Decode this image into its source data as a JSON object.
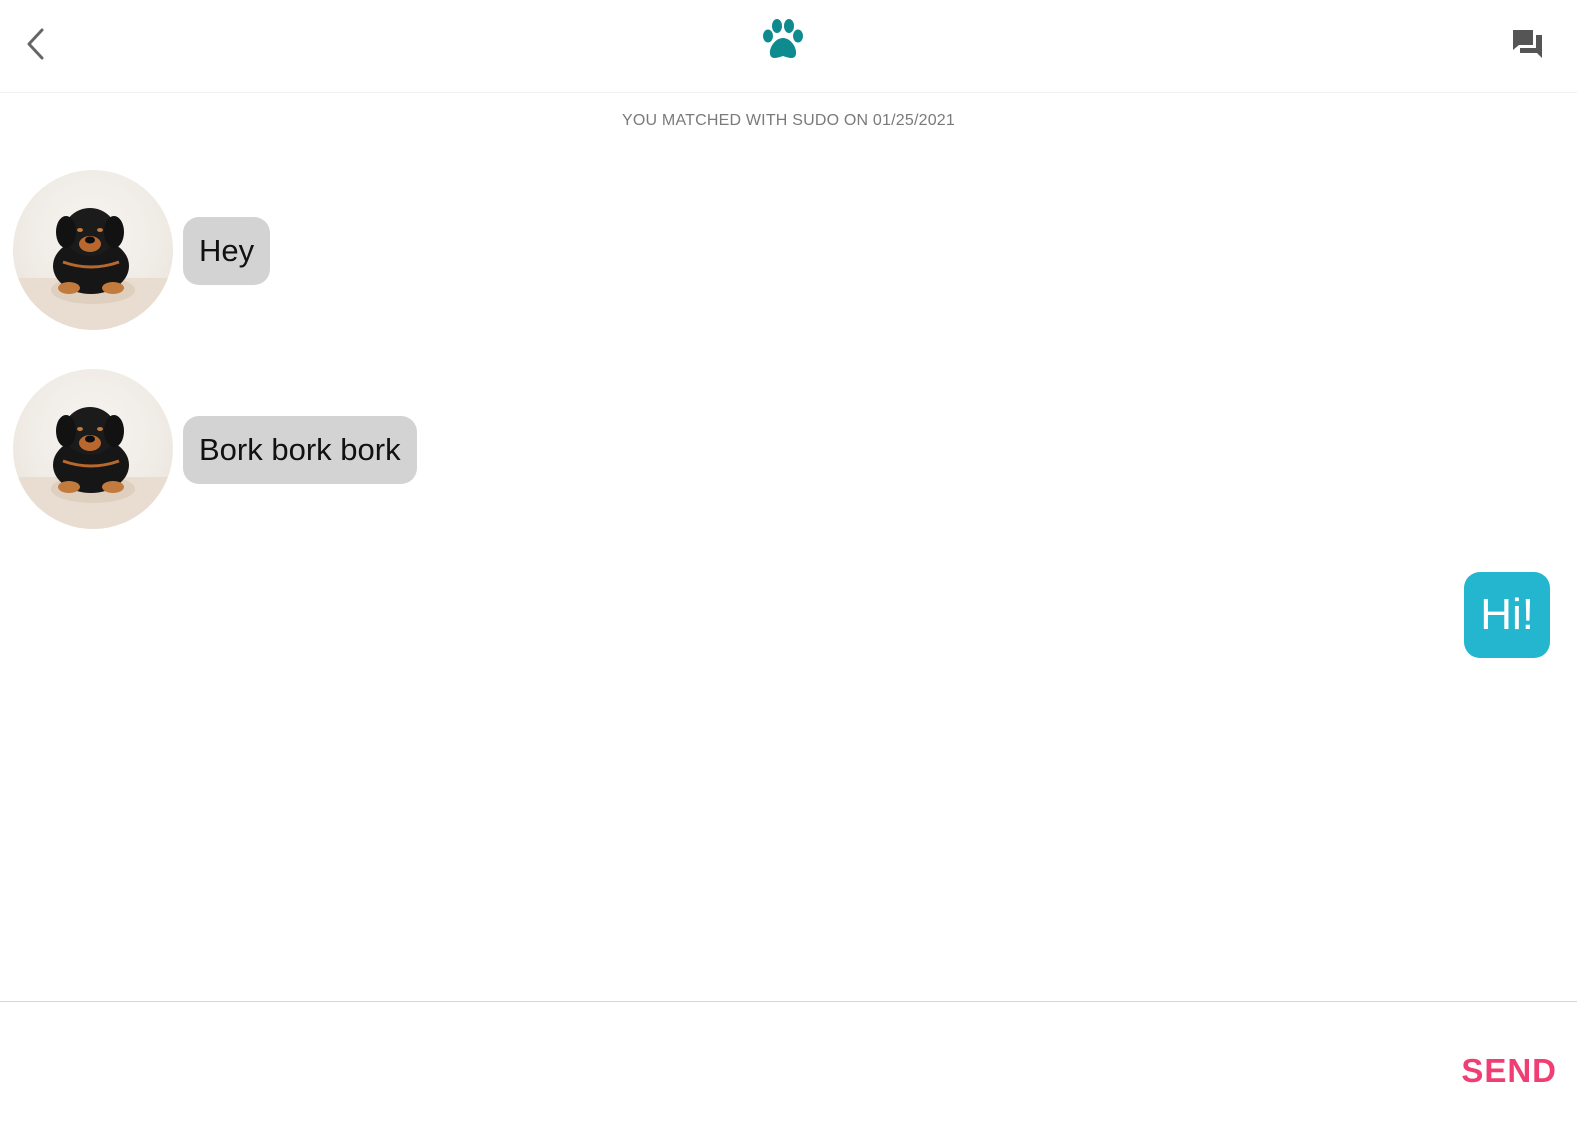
{
  "header": {
    "back_icon": "chevron-left-icon",
    "logo_icon": "paw-icon",
    "chat_icon": "chat-bubbles-icon"
  },
  "colors": {
    "accent": "#0f8a8e",
    "incoming_bubble": "#d3d3d3",
    "outgoing_bubble": "#24b5cf",
    "send": "#f03d74"
  },
  "match_banner": "YOU MATCHED WITH SUDO ON 01/25/2021",
  "messages": [
    {
      "from": "match",
      "text": "Hey"
    },
    {
      "from": "match",
      "text": "Bork bork bork"
    },
    {
      "from": "me",
      "text": "Hi!"
    }
  ],
  "composer": {
    "placeholder": "",
    "send_label": "SEND"
  }
}
